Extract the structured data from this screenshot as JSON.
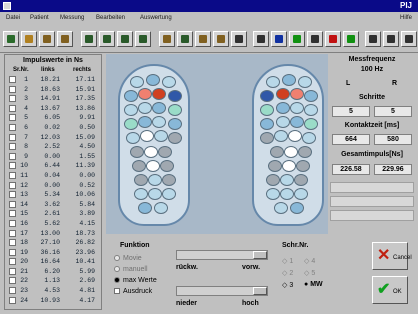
{
  "window": {
    "title": "PIJ"
  },
  "menu": {
    "items": [
      "Datei",
      "Patient",
      "Messung",
      "Bearbeiten",
      "Auswertung"
    ],
    "help": "Hilfe"
  },
  "toolbar": {
    "buttons": [
      {
        "icon": "new-icon",
        "color": "#2a6a2a"
      },
      {
        "icon": "open-icon",
        "color": "#b08020"
      },
      {
        "icon": "patient-icon",
        "color": "#806020"
      },
      {
        "icon": "foot-icon",
        "color": "#806020"
      },
      {
        "icon": "graph-icon",
        "color": "#2a5a2a"
      },
      {
        "icon": "chart-icon",
        "color": "#2a5a2a"
      },
      {
        "icon": "wave-icon",
        "color": "#2a5a2a"
      },
      {
        "icon": "measure-icon",
        "color": "#2a5a2a"
      },
      {
        "icon": "balance-icon",
        "color": "#806020"
      },
      {
        "icon": "compare-icon",
        "color": "#2a5a2a"
      },
      {
        "icon": "sensor-icon",
        "color": "#806020"
      },
      {
        "icon": "grid-icon",
        "color": "#806020"
      },
      {
        "icon": "copy-icon",
        "color": "#303030"
      },
      {
        "icon": "print-icon",
        "color": "#303030"
      },
      {
        "icon": "help-icon",
        "color": "#1030a0"
      },
      {
        "icon": "green-icon",
        "color": "#109010"
      },
      {
        "icon": "scale-icon",
        "color": "#303030"
      },
      {
        "icon": "record-icon",
        "color": "#c01010"
      },
      {
        "icon": "go-icon",
        "color": "#109010"
      },
      {
        "icon": "arrow-icon",
        "color": "#303030"
      },
      {
        "icon": "zoom-icon",
        "color": "#303030"
      },
      {
        "icon": "exit-icon",
        "color": "#303030"
      }
    ]
  },
  "impulse_table": {
    "title": "Impulswerte in Ns",
    "headers": [
      "Sr.Nr.",
      "links",
      "rechts"
    ],
    "rows": [
      [
        "1",
        "18.21",
        "17.11"
      ],
      [
        "2",
        "18.63",
        "15.91"
      ],
      [
        "3",
        "14.91",
        "17.35"
      ],
      [
        "4",
        "13.67",
        "13.86"
      ],
      [
        "5",
        "6.05",
        "9.91"
      ],
      [
        "6",
        "0.02",
        "0.50"
      ],
      [
        "7",
        "12.03",
        "15.09"
      ],
      [
        "8",
        "2.52",
        "4.50"
      ],
      [
        "9",
        "0.00",
        "1.55"
      ],
      [
        "10",
        "6.44",
        "11.39"
      ],
      [
        "11",
        "0.04",
        "0.00"
      ],
      [
        "12",
        "0.00",
        "0.52"
      ],
      [
        "13",
        "5.34",
        "10.06"
      ],
      [
        "14",
        "3.62",
        "5.84"
      ],
      [
        "15",
        "2.61",
        "3.89"
      ],
      [
        "16",
        "5.62",
        "4.15"
      ],
      [
        "17",
        "13.00",
        "18.73"
      ],
      [
        "18",
        "27.10",
        "26.82"
      ],
      [
        "19",
        "36.16",
        "23.96"
      ],
      [
        "20",
        "16.64",
        "10.41"
      ],
      [
        "21",
        "6.20",
        "5.99"
      ],
      [
        "22",
        "1.13",
        "2.69"
      ],
      [
        "23",
        "4.53",
        "4.81"
      ],
      [
        "24",
        "10.93",
        "4.17"
      ]
    ]
  },
  "measurements": {
    "frequency_label": "Messfrequenz",
    "frequency_value": "100 Hz",
    "left_label": "L",
    "right_label": "R",
    "steps_label": "Schritte",
    "steps_left": "5",
    "steps_right": "5",
    "contact_label": "Kontaktzeit [ms]",
    "contact_left": "664",
    "contact_right": "580",
    "impulse_label": "Gesamtimpuls[Ns]",
    "impulse_left": "226.58",
    "impulse_right": "229.96"
  },
  "sensor_colors": {
    "palette": {
      "white": "#ffffff",
      "light": "#b8d8e8",
      "mid": "#88b8d8",
      "cyan": "#9adcc8",
      "dark": "#3058a8",
      "red": "#d04020",
      "salmon": "#f08070",
      "gray": "#a0a8b0"
    }
  },
  "funktion": {
    "title": "Funktion",
    "options": [
      {
        "label": "Movie",
        "enabled": false
      },
      {
        "label": "manuell",
        "enabled": false
      },
      {
        "label": "max Werte",
        "enabled": true,
        "selected": true
      }
    ],
    "checkbox_label": "Ausdruck"
  },
  "sliders": {
    "top_left_label": "rückw.",
    "top_right_label": "vorw.",
    "bottom_left_label": "nieder",
    "bottom_right_label": "hoch"
  },
  "schritt": {
    "title": "Schr.Nr.",
    "options": [
      "1",
      "2",
      "3",
      "4",
      "5",
      "MW"
    ],
    "selected": "MW"
  },
  "buttons": {
    "cancel": "Cancel",
    "ok": "OK"
  }
}
